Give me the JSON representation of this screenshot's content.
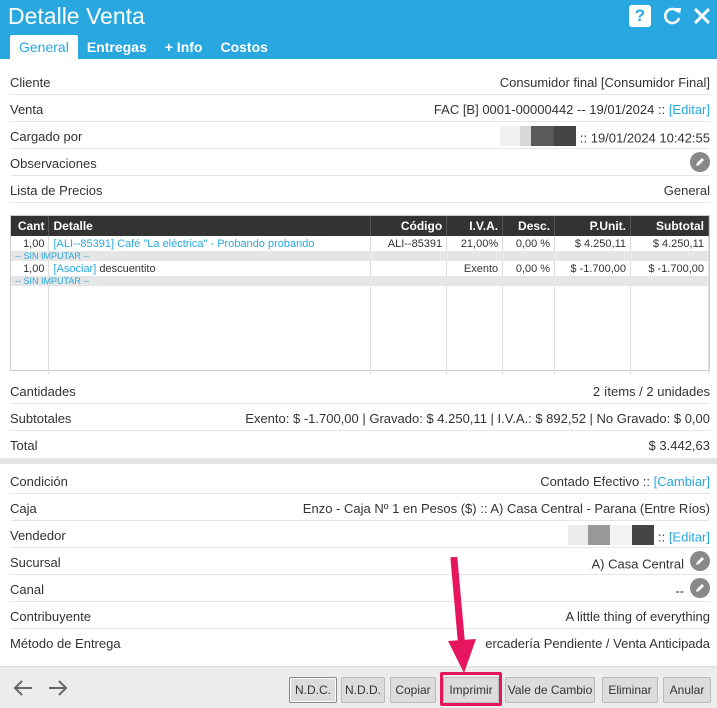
{
  "header": {
    "title": "Detalle Venta",
    "tabs": [
      "General",
      "Entregas",
      "+ Info",
      "Costos"
    ]
  },
  "info": {
    "cliente_label": "Cliente",
    "cliente_value": "Consumidor final [Consumidor Final]",
    "venta_label": "Venta",
    "venta_value": "FAC [B] 0001-00000442 -- 19/01/2024 :: ",
    "editar": "[Editar]",
    "cargado_label": "Cargado por",
    "cargado_value": ":: 19/01/2024 10:42:55",
    "observaciones_label": "Observaciones",
    "lista_label": "Lista de Precios",
    "lista_value": "General"
  },
  "grid": {
    "headers": [
      "Cant",
      "Detalle",
      "Código",
      "I.V.A.",
      "Desc.",
      "P.Unit.",
      "Subtotal"
    ],
    "rows": [
      {
        "cant": "1,00",
        "link": "[ALI--85391] Café \"La eléctrica\" - Probando probando",
        "text": "",
        "codigo": "ALI--85391",
        "iva": "21,00%",
        "desc": "0,00 %",
        "punit": "$ 4.250,11",
        "subtotal": "$ 4.250,11",
        "note": "-- SIN IMPUTAR --"
      },
      {
        "cant": "1,00",
        "link": "[Asociar]",
        "text": " descuentito",
        "codigo": "",
        "iva": "Exento",
        "desc": "0,00 %",
        "punit": "$ -1.700,00",
        "subtotal": "$ -1.700,00",
        "note": "-- SIN IMPUTAR --"
      }
    ]
  },
  "totals": {
    "cantidades_label": "Cantidades",
    "cantidades_value": "2 ítems / 2 unidades",
    "subtotales_label": "Subtotales",
    "subtotales_value": "Exento: $ -1.700,00 | Gravado: $ 4.250,11 | I.V.A.: $ 892,52 | No Gravado: $ 0,00",
    "total_label": "Total",
    "total_value": "$ 3.442,63"
  },
  "details": {
    "condicion_label": "Condición",
    "condicion_value": "Contado Efectivo :: ",
    "cambiar": "[Cambiar]",
    "caja_label": "Caja",
    "caja_value": "Enzo - Caja Nº 1 en Pesos ($) :: A) Casa Central - Parana (Entre Ríos)",
    "vendedor_label": "Vendedor",
    "vendedor_sep": " :: ",
    "editar": "[Editar]",
    "sucursal_label": "Sucursal",
    "sucursal_value": "A) Casa Central",
    "canal_label": "Canal",
    "canal_value": "--",
    "contribuyente_label": "Contribuyente",
    "contribuyente_value": "A little thing of everything",
    "metodo_label": "Método de Entrega",
    "metodo_value": "ercadería Pendiente / Venta Anticipada"
  },
  "footer": {
    "buttons": [
      "N.D.C.",
      "N.D.D.",
      "Copiar",
      "Imprimir",
      "Vale de Cambio",
      "Eliminar",
      "Anular"
    ]
  },
  "colors": {
    "accent": "#29a8e0",
    "highlight": "#e6165e",
    "header_dark": "#333333"
  }
}
